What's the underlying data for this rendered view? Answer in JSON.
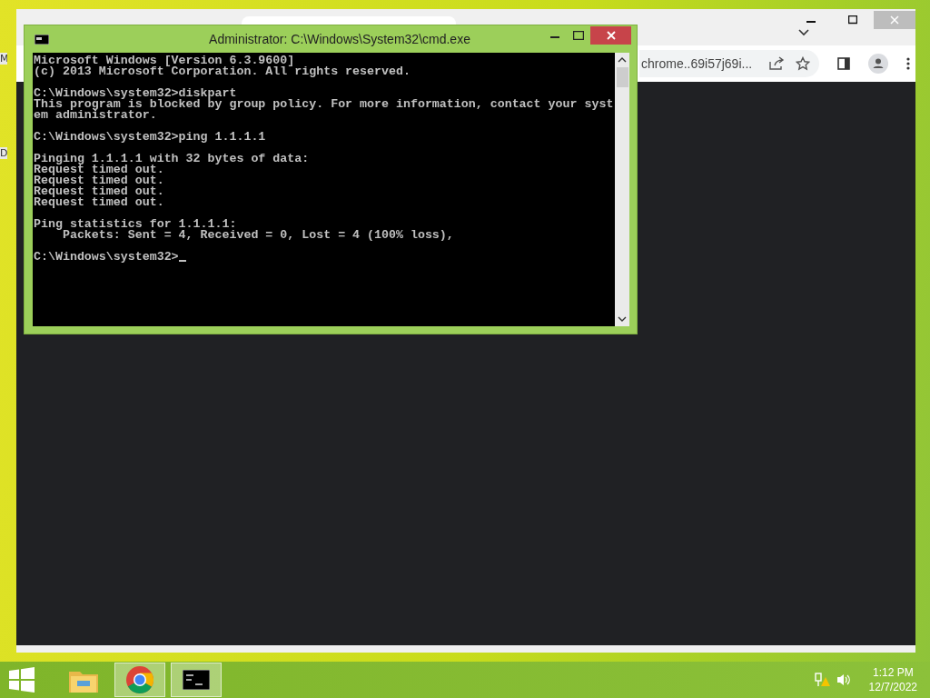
{
  "desktop_labels": [
    "M",
    "D"
  ],
  "browser": {
    "address": "chrome..69i57j69i..."
  },
  "console": {
    "title": "Administrator: C:\\Windows\\System32\\cmd.exe",
    "blocks": [
      [
        "Microsoft Windows [Version 6.3.9600]",
        "(c) 2013 Microsoft Corporation. All rights reserved."
      ],
      [
        "C:\\Windows\\system32>diskpart",
        "This program is blocked by group policy. For more information, contact your syst",
        "em administrator."
      ],
      [
        "C:\\Windows\\system32>ping 1.1.1.1"
      ],
      [
        "Pinging 1.1.1.1 with 32 bytes of data:",
        "Request timed out.",
        "Request timed out.",
        "Request timed out.",
        "Request timed out."
      ],
      [
        "Ping statistics for 1.1.1.1:",
        "    Packets: Sent = 4, Received = 0, Lost = 4 (100% loss),"
      ],
      [
        "C:\\Windows\\system32>"
      ]
    ]
  },
  "taskbar": {
    "apps": [
      {
        "kind": "folder",
        "selected": false
      },
      {
        "kind": "browser",
        "selected": true
      },
      {
        "kind": "console",
        "selected": true
      }
    ],
    "time": "1:12 PM",
    "date": "12/7/2022"
  }
}
